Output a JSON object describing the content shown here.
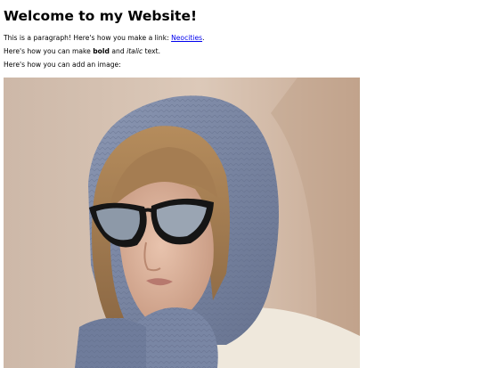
{
  "page": {
    "heading": "Welcome to my Website!",
    "paragraph1": {
      "text": "This is a paragraph! Here's how you make a link: ",
      "link_label": "Neocities",
      "suffix": "."
    },
    "paragraph2": {
      "prefix": "Here's how you can make ",
      "bold": "bold",
      "middle": " and ",
      "italic": "italic",
      "suffix": " text."
    },
    "paragraph3": {
      "text": "Here's how you can add an image:"
    }
  },
  "colors": {
    "link": "#0000ee",
    "hood": "#7d8aa8",
    "wall": "#d8c4b3"
  }
}
